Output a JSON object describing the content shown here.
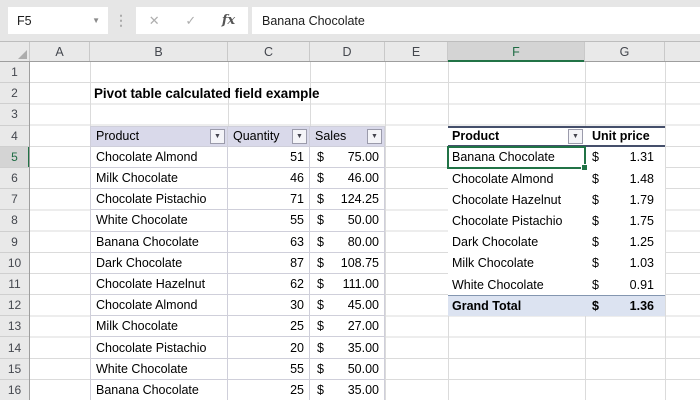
{
  "formula_bar": {
    "name_box": "F5",
    "formula": "Banana Chocolate",
    "cancel_icon": "✕",
    "enter_icon": "✓",
    "fx_icon": "fx",
    "separator_icon": "⋮",
    "namebox_chevron_icon": "▼"
  },
  "grid": {
    "column_headers": [
      "A",
      "B",
      "C",
      "D",
      "E",
      "F",
      "G"
    ],
    "row_headers": [
      "1",
      "2",
      "3",
      "4",
      "5",
      "6",
      "7",
      "8",
      "9",
      "10",
      "11",
      "12",
      "13",
      "14",
      "15",
      "16"
    ],
    "selected_cell": "F5",
    "selected_column": "F",
    "selected_row": "5"
  },
  "title_cell": "Pivot table calculated field example",
  "icons": {
    "filter_icon": "▼"
  },
  "source_table": {
    "columns": [
      "Product",
      "Quantity",
      "Sales"
    ],
    "currency": "$",
    "rows": [
      {
        "product": "Chocolate Almond",
        "quantity": "51",
        "sales": "75.00"
      },
      {
        "product": "Milk Chocolate",
        "quantity": "46",
        "sales": "46.00"
      },
      {
        "product": "Chocolate Pistachio",
        "quantity": "71",
        "sales": "124.25"
      },
      {
        "product": "White Chocolate",
        "quantity": "55",
        "sales": "50.00"
      },
      {
        "product": "Banana Chocolate",
        "quantity": "63",
        "sales": "80.00"
      },
      {
        "product": "Dark Chocolate",
        "quantity": "87",
        "sales": "108.75"
      },
      {
        "product": "Chocolate Hazelnut",
        "quantity": "62",
        "sales": "111.00"
      },
      {
        "product": "Chocolate Almond",
        "quantity": "30",
        "sales": "45.00"
      },
      {
        "product": "Milk Chocolate",
        "quantity": "25",
        "sales": "27.00"
      },
      {
        "product": "Chocolate Pistachio",
        "quantity": "20",
        "sales": "35.00"
      },
      {
        "product": "White Chocolate",
        "quantity": "55",
        "sales": "50.00"
      },
      {
        "product": "Banana Chocolate",
        "quantity": "25",
        "sales": "35.00"
      }
    ]
  },
  "pivot_table": {
    "columns": [
      "Product",
      "Unit price"
    ],
    "currency": "$",
    "rows": [
      {
        "product": "Banana Chocolate",
        "unit_price": "1.31"
      },
      {
        "product": "Chocolate Almond",
        "unit_price": "1.48"
      },
      {
        "product": "Chocolate Hazelnut",
        "unit_price": "1.79"
      },
      {
        "product": "Chocolate Pistachio",
        "unit_price": "1.75"
      },
      {
        "product": "Dark Chocolate",
        "unit_price": "1.25"
      },
      {
        "product": "Milk Chocolate",
        "unit_price": "1.03"
      },
      {
        "product": "White Chocolate",
        "unit_price": "0.91"
      }
    ],
    "grand_total": {
      "label": "Grand Total",
      "unit_price": "1.36"
    }
  },
  "colors": {
    "selection_green": "#217346",
    "pivot_border": "#454f6b",
    "grand_total_bg": "#dce3f1",
    "source_header_bg": "#d9d9ea",
    "gridline": "#dbdbdb"
  }
}
